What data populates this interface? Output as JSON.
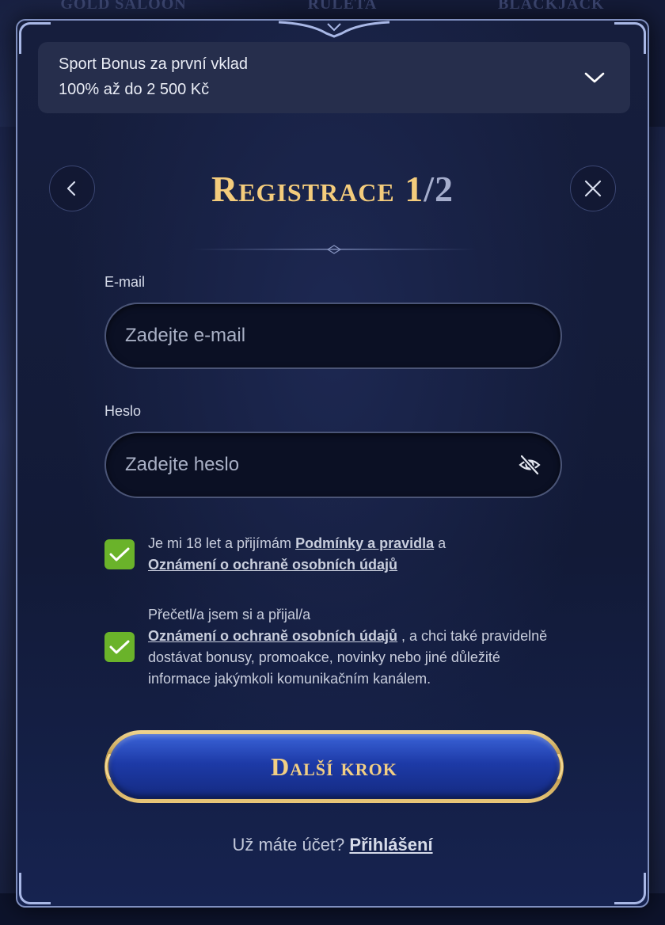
{
  "background": {
    "nav_items": [
      "GOLD SALOON",
      "RULETA",
      "BLACKJACK"
    ]
  },
  "bonus": {
    "title": "Sport Bonus za první vklad",
    "subtitle": "100% až do 2 500 Kč",
    "icon": "chevron-down-icon"
  },
  "header": {
    "title_main": "Registrace 1",
    "title_sep": "/",
    "title_total": "2",
    "back_icon": "chevron-left-icon",
    "close_icon": "close-icon"
  },
  "form": {
    "email_label": "E-mail",
    "email_placeholder": "Zadejte e-mail",
    "password_label": "Heslo",
    "password_placeholder": "Zadejte heslo",
    "password_icon": "eye-off-icon",
    "consent1": {
      "checked": true,
      "text_before": "Je mi 18 let a přijímám ",
      "link1": "Podmínky a pravidla",
      "text_mid": " a",
      "link2": "Oznámení o ochraně osobních údajů"
    },
    "consent2": {
      "checked": true,
      "text_before": "Přečetl/a jsem si a přijal/a",
      "link": "Oznámení o ochraně osobních údajů",
      "text_after": " , a chci také pravidelně dostávat bonusy, promoakce, novinky nebo jiné důležité informace jakýmkoli komunikačním kanálem."
    },
    "submit_label": "Další krok"
  },
  "footer": {
    "question": "Už máte účet?",
    "login_link": "Přihlášení"
  },
  "colors": {
    "gold": "#f4cc7c",
    "checkbox_green": "#6ab32a",
    "button_blue": "#1d3aa7"
  }
}
